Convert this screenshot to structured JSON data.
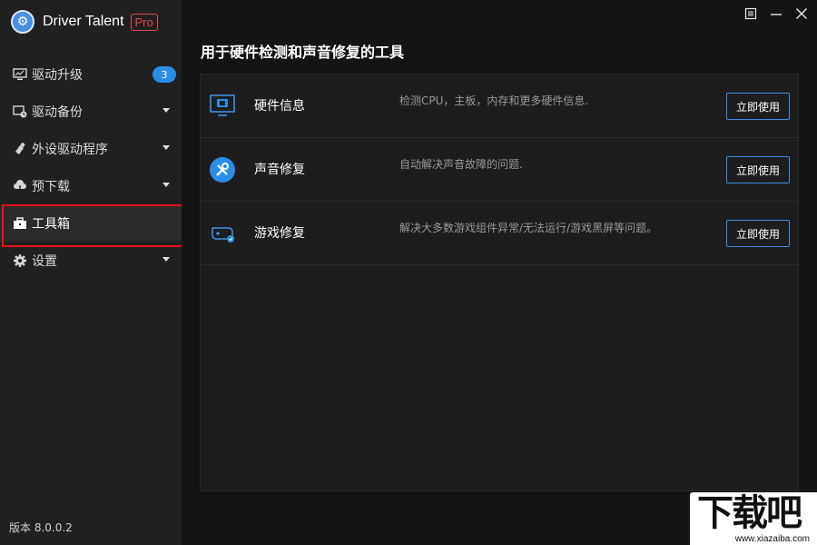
{
  "app": {
    "name": "Driver Talent",
    "edition": "Pro",
    "version": "版本 8.0.0.2"
  },
  "window_controls": [
    {
      "name": "menu",
      "icon": "menu-icon"
    },
    {
      "name": "minimize",
      "icon": "minimize-icon"
    },
    {
      "name": "close",
      "icon": "close-icon"
    }
  ],
  "sidebar": {
    "items": [
      {
        "label": "驱动升级",
        "icon": "monitor-icon",
        "badge": "3"
      },
      {
        "label": "驱动备份",
        "icon": "backup-icon"
      },
      {
        "label": "外设驱动程序",
        "icon": "usb-icon"
      },
      {
        "label": "预下载",
        "icon": "cloud-download-icon"
      },
      {
        "label": "工具箱",
        "icon": "toolbox-icon",
        "active": true
      },
      {
        "label": "设置",
        "icon": "gear-icon"
      }
    ]
  },
  "main": {
    "title": "用于硬件检测和声音修复的工具",
    "tools": [
      {
        "name": "硬件信息",
        "description": "检测CPU，主板，内存和更多硬件信息.",
        "button": "立即使用",
        "icon": "hardware-info-icon"
      },
      {
        "name": "声音修复",
        "description": "自动解决声音故障的问题.",
        "button": "立即使用",
        "icon": "sound-repair-icon"
      },
      {
        "name": "游戏修复",
        "description": "解决大多数游戏组件异常/无法运行/游戏黑屏等问题。",
        "button": "立即使用",
        "icon": "game-repair-icon"
      }
    ]
  },
  "watermark": {
    "text": "下载吧",
    "url": "www.xiazaiba.com"
  },
  "colors": {
    "accent": "#2a8de6",
    "highlight_border": "#e2141b",
    "pro_badge": "#e0494b",
    "sidebar_bg": "#202020",
    "main_bg": "#141414"
  }
}
